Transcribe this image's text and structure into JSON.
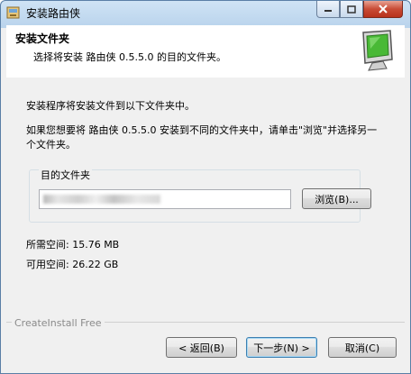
{
  "window": {
    "title": "安装路由侠"
  },
  "header": {
    "title": "安装文件夹",
    "subtitle": "选择将安装 路由侠 0.5.5.0 的目的文件夹。"
  },
  "body": {
    "intro": "安装程序将安装文件到以下文件夹中。",
    "instruction": "如果您想要将 路由侠 0.5.5.0 安装到不同的文件夹中，请单击\"浏览\"并选择另一个文件夹。",
    "group_label": "目的文件夹",
    "browse_label": "浏览(B)...",
    "space_required": "所需空间: 15.76 MB",
    "space_available": "可用空间: 26.22 GB"
  },
  "footer": {
    "brand": "CreateInstall Free",
    "back_label": "< 返回(B)",
    "next_label": "下一步(N) >",
    "cancel_label": "取消(C)"
  }
}
